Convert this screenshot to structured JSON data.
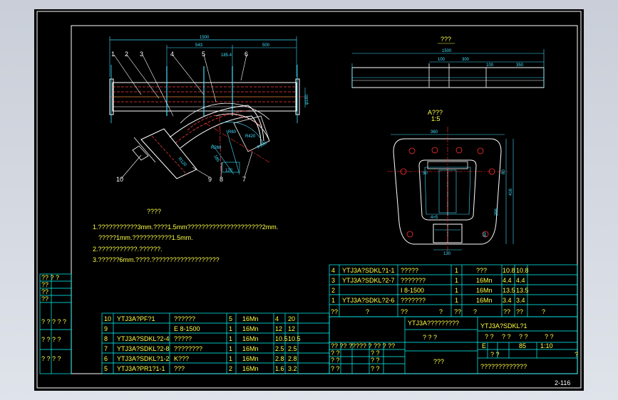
{
  "drawing": {
    "sheet_number": "2-116",
    "colors": {
      "background": "#000000",
      "frame": "#ffffff",
      "table": "#00ffff",
      "text": "#ffff44",
      "dim": "#40e0ff",
      "part": "#66ff66",
      "center": "#ff3030",
      "bend": "#ff4040"
    }
  },
  "main_view": {
    "dims": {
      "overall": "1500",
      "seg1": "543",
      "seg2": "500",
      "small": "185.4",
      "vert": "φ180"
    },
    "callouts": [
      "1",
      "2",
      "3",
      "4",
      "5",
      "6",
      "7",
      "8",
      "9",
      "10"
    ],
    "radius_labels": [
      "R60",
      "R420",
      "R260",
      "R120",
      "R180",
      "120",
      "185"
    ]
  },
  "top_view": {
    "title": "???",
    "dims": {
      "overall": "1500",
      "a": "100",
      "b": "300",
      "c": "100",
      "d": "350"
    }
  },
  "section_view": {
    "title": "A???",
    "scale": "1:5",
    "dims": {
      "top": "360",
      "w1": "50",
      "h1": "80",
      "h2": "416",
      "h3": "256",
      "h4": "80",
      "bottom": "130",
      "weld": "4×5"
    }
  },
  "notes": {
    "heading": "????",
    "lines": [
      "1.???????????3mm.????1.5mm?????????????????????2mm.",
      "?????1mm.???????????1.5mm.",
      "2.???????????.??????.",
      "3.??????6mm.????.???????????????????"
    ]
  },
  "left_stamps": [
    "?? ? ?",
    "??",
    "??",
    "??",
    "? ? ? ? ?",
    "? ? ? ?",
    "? ? ? ?"
  ],
  "bom_upper": {
    "rows": [
      {
        "no": "4",
        "code": "YTJ3A?SDKL?1-1",
        "name": "?????",
        "qty": "1",
        "mat": "???",
        "w1": "10.8",
        "w2": "10.8"
      },
      {
        "no": "3",
        "code": "YTJ3A?SDKL?2-7",
        "name": "???????",
        "qty": "1",
        "mat": "16Mn",
        "w1": "4.4",
        "w2": "4.4"
      },
      {
        "no": "2",
        "code": "",
        "name": "I 8-1500",
        "qty": "1",
        "mat": "16Mn",
        "w1": "13.5",
        "w2": "13.5"
      },
      {
        "no": "1",
        "code": "YTJ3A?SDKL?2-6",
        "name": "???????",
        "qty": "1",
        "mat": "16Mn",
        "w1": "3.4",
        "w2": "3.4"
      }
    ],
    "header": [
      "??",
      "?",
      "??",
      "?",
      "??",
      "?",
      "??",
      "??",
      "?"
    ]
  },
  "bom_lower": {
    "rows": [
      {
        "no": "10",
        "code": "YTJ3A?PF?1",
        "name": "??????",
        "qty": "5",
        "mat": "16Mn",
        "w1": "4",
        "w2": "20"
      },
      {
        "no": "9",
        "code": "",
        "name": "E 8-1500",
        "qty": "1",
        "mat": "16Mn",
        "w1": "12",
        "w2": "12"
      },
      {
        "no": "8",
        "code": "YTJ3A?SDKL?2-4",
        "name": "?????",
        "qty": "1",
        "mat": "16Mn",
        "w1": "10.5",
        "w2": "10.5"
      },
      {
        "no": "7",
        "code": "YTJ3A?SDKL?2-8",
        "name": "????????",
        "qty": "1",
        "mat": "16Mn",
        "w1": "2.5",
        "w2": "2.5"
      },
      {
        "no": "6",
        "code": "YTJ3A?SDKL?1-2",
        "name": "K???",
        "qty": "1",
        "mat": "16Mn",
        "w1": "2.8",
        "w2": "2.8"
      },
      {
        "no": "5",
        "code": "YTJ3A?PR1?1-1",
        "name": "???",
        "qty": "2",
        "mat": "16Mn",
        "w1": "1.6",
        "w2": "3.2"
      }
    ]
  },
  "title_block": {
    "company_code": "YTJ3A?????????",
    "drawing_no": "YTJ3A?SDKL?1",
    "title": "? ? ?",
    "unit": "???",
    "weight": "85",
    "scale": "1:10",
    "stage": "E",
    "product": "?????????????",
    "sign_row": "?? ?? ????? ? ?? ? ??",
    "cells": [
      "? ?",
      "? ?",
      "? ?",
      "? ?",
      "? ?",
      "? ?"
    ],
    "small_q": [
      "? ?",
      "? ?",
      "? ?",
      "? ?",
      "? ?",
      "?"
    ]
  }
}
